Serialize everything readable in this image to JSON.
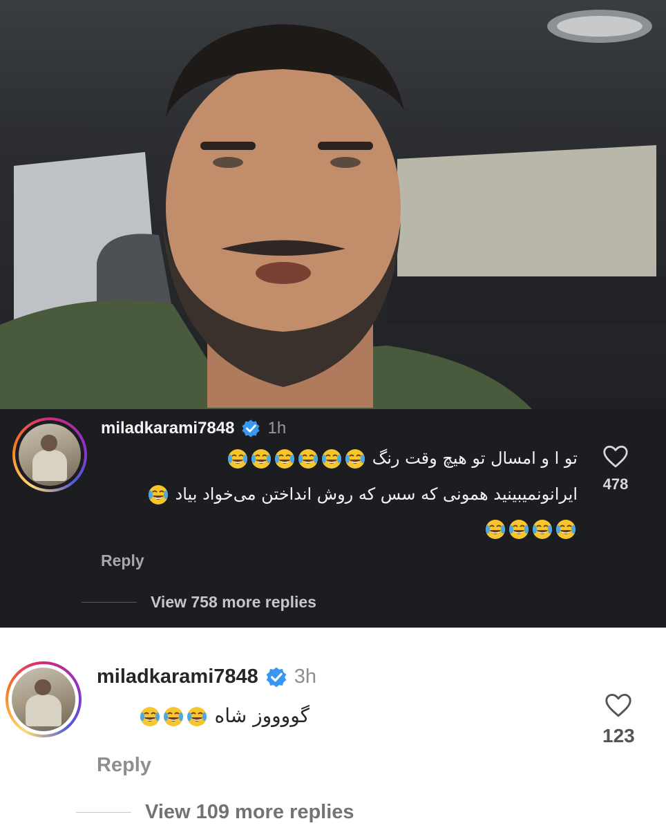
{
  "comments": [
    {
      "username": "miladkarami7848",
      "time": "1h",
      "lines": [
        {
          "text": "تو ا و امسال تو هیچ وقت رنگ",
          "emoji_after": 6
        },
        {
          "text": "ایرانونمیبینید  همونی که سس که روش انداختن می‌خواد بیاد",
          "emoji_after": 1
        },
        {
          "text": "",
          "emoji_after": 4
        }
      ],
      "like_count": "478",
      "reply_label": "Reply",
      "view_replies": "View 758 more replies"
    },
    {
      "username": "miladkarami7848",
      "time": "3h",
      "lines": [
        {
          "text": "گووووز شاه",
          "emoji_after": 3
        }
      ],
      "like_count": "123",
      "reply_label": "Reply",
      "view_replies": "View 109 more replies"
    }
  ],
  "icons": {
    "verified": "verified-badge-icon",
    "like": "heart-outline-icon",
    "emoji": "face-with-tears-of-joy-emoji"
  },
  "colors": {
    "verified_blue": "#3897f0",
    "dark_bg": "#1c1d21",
    "muted_text": "#a8a8a8"
  }
}
